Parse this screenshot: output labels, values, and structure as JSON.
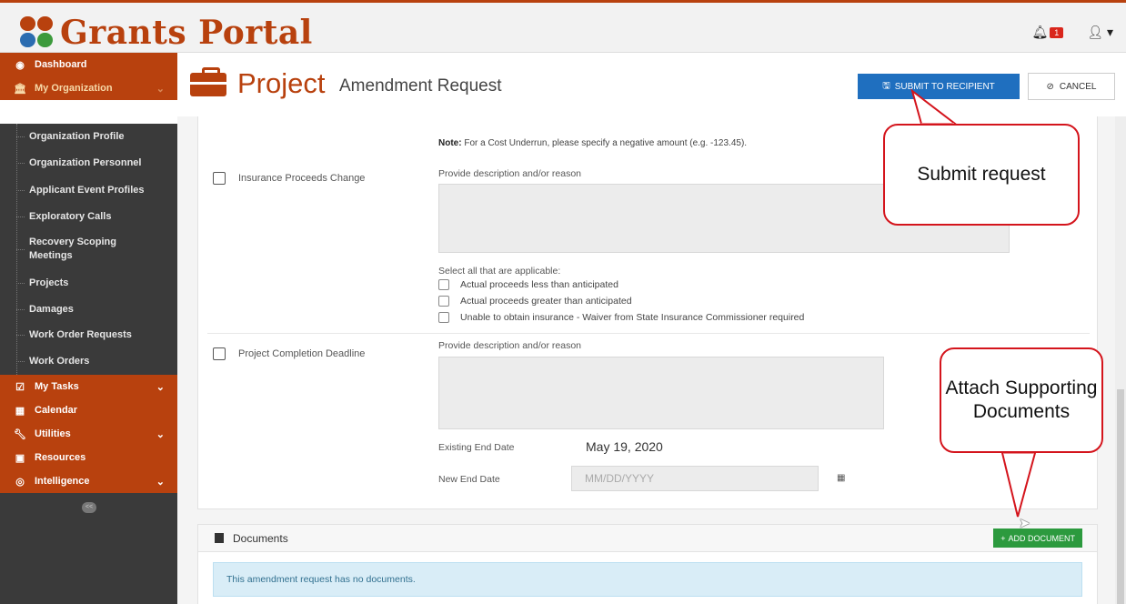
{
  "brand": {
    "name": "Grants Portal"
  },
  "topbar": {
    "notification_count": "1"
  },
  "sidebar": {
    "top_items": [
      {
        "label": "Dashboard",
        "icon": "dashboard-icon"
      },
      {
        "label": "My Organization",
        "icon": "bank-icon"
      }
    ],
    "sub_items": [
      "Organization Profile",
      "Organization Personnel",
      "Applicant Event Profiles",
      "Exploratory Calls",
      "Recovery Scoping Meetings",
      "Projects",
      "Damages",
      "Work Order Requests",
      "Work Orders"
    ],
    "bottom_items": [
      {
        "label": "My Tasks",
        "icon": "checkbox-icon",
        "has_chevron": true
      },
      {
        "label": "Calendar",
        "icon": "calendar-icon",
        "has_chevron": false
      },
      {
        "label": "Utilities",
        "icon": "wrench-icon",
        "has_chevron": true
      },
      {
        "label": "Resources",
        "icon": "resources-icon",
        "has_chevron": false
      },
      {
        "label": "Intelligence",
        "icon": "eye-icon",
        "has_chevron": true
      }
    ],
    "collapse_label": "<<"
  },
  "header": {
    "title": "Project",
    "subtitle": "Amendment Request",
    "submit_label": "SUBMIT TO RECIPIENT",
    "cancel_label": "CANCEL"
  },
  "form": {
    "note_bold": "Note:",
    "note_text": "For a Cost Underrun, please specify a negative amount (e.g. -123.45).",
    "insurance": {
      "label": "Insurance Proceeds Change",
      "textarea_label": "Provide description and/or reason",
      "select_label": "Select all that are applicable:",
      "options": [
        "Actual proceeds less than anticipated",
        "Actual proceeds greater than anticipated",
        "Unable to obtain insurance - Waiver from State Insurance Commissioner required"
      ]
    },
    "deadline": {
      "label": "Project Completion Deadline",
      "textarea_label": "Provide description and/or reason",
      "existing_label": "Existing End Date",
      "existing_value": "May 19, 2020",
      "new_label": "New End Date",
      "new_placeholder": "MM/DD/YYYY"
    }
  },
  "documents": {
    "title": "Documents",
    "add_label": "ADD DOCUMENT",
    "empty_message": "This amendment request has no documents."
  },
  "callouts": {
    "submit": "Submit request",
    "attach": "Attach Supporting Documents"
  },
  "colors": {
    "brand_orange": "#b8410e",
    "sidebar_dark": "#3a3a3a",
    "submit_blue": "#1f6fbf",
    "add_green": "#2c9a3e",
    "callout_red": "#d4141c",
    "info_blue": "#d9edf7"
  }
}
